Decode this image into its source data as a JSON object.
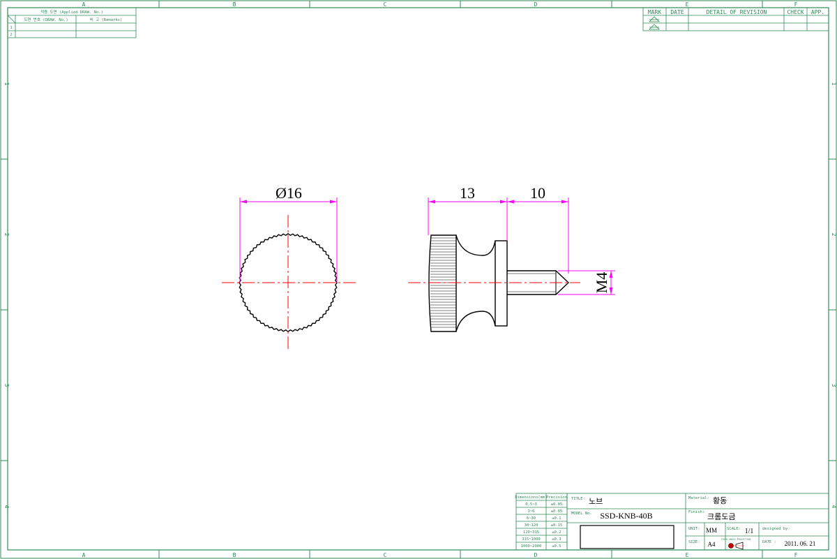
{
  "colors": {
    "frame": "#2e8b57",
    "part": "#000000",
    "dimension": "#ff00ff",
    "centerline": "#ff0000"
  },
  "zones": {
    "columns": [
      "A",
      "B",
      "C",
      "D",
      "E",
      "F"
    ],
    "rows": [
      "1",
      "2",
      "3",
      "4"
    ]
  },
  "applied_drawing_table": {
    "header": "적용 도면 (Applied DRAW. No.)",
    "col_draw_no": "도면 번호 (DRAW. No.)",
    "col_remarks": "비 고 (Remarks)",
    "rows": [
      "1",
      "2"
    ]
  },
  "revision_table": {
    "headers": [
      "MARK",
      "DATE",
      "DETAIL OF REVISION",
      "CHECK",
      "APP."
    ]
  },
  "dimensions": {
    "diameter": "Ø16",
    "head_length": "13",
    "thread_length": "10",
    "thread_size": "M4"
  },
  "tolerance_table": {
    "header_dim": "Dimensions(mm)",
    "header_prec": "Precision",
    "rows": [
      {
        "range": "0.5~3",
        "tol": "±0.05"
      },
      {
        "range": "3~6",
        "tol": "±0.05"
      },
      {
        "range": "6~30",
        "tol": "±0.1"
      },
      {
        "range": "30~120",
        "tol": "±0.15"
      },
      {
        "range": "120~315",
        "tol": "±0.2"
      },
      {
        "range": "315~1000",
        "tol": "±0.3"
      },
      {
        "range": "1000~2000",
        "tol": "±0.5"
      }
    ]
  },
  "title_block": {
    "title_label": "TITLE:",
    "title_value": "노브",
    "model_label": "MODEL No.",
    "model_value": "SSD-KNB-40B",
    "material_label": "Material:",
    "material_value": "황동",
    "finish_label": "Finish:",
    "finish_value": "크롬도금",
    "unit_label": "UNIT:",
    "unit_value": "MM",
    "scale_label": "SCALE:",
    "scale_value": "1/1",
    "designed_label": "designed by:",
    "size_label": "SIZE:",
    "size_value": "A4",
    "date_label": "DATE :",
    "date_value": "2011. 06. 21",
    "projection_label": "THIRD ANGLE PROJECTION"
  }
}
